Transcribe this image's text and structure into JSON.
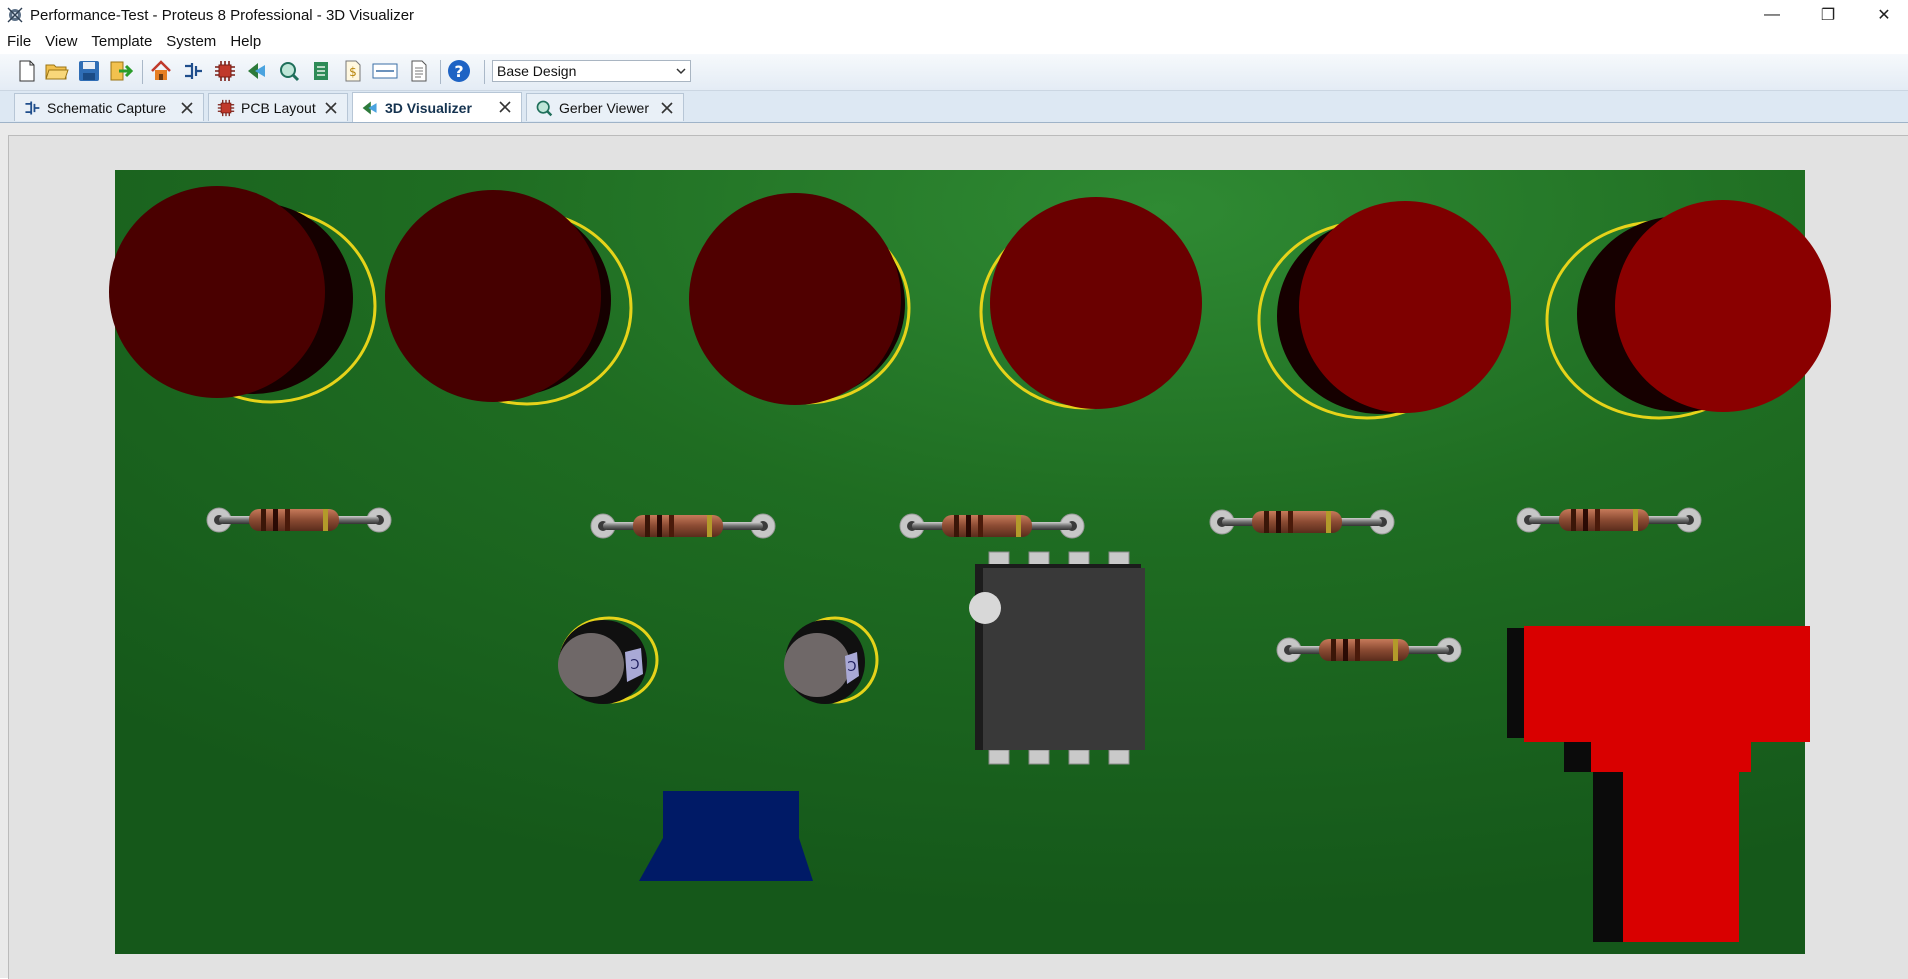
{
  "window": {
    "title": "Performance-Test - Proteus 8 Professional - 3D Visualizer",
    "controls": {
      "minimize": "—",
      "restore": "❐",
      "close": "✕"
    }
  },
  "menu": {
    "items": [
      "File",
      "View",
      "Template",
      "System",
      "Help"
    ]
  },
  "toolbar": {
    "buttons": [
      "new-file-icon",
      "open-folder-icon",
      "save-icon",
      "import-icon",
      "home-icon",
      "schematic-icon",
      "pcb-icon",
      "3d-visualizer-icon",
      "gerber-icon",
      "bom-icon",
      "cost-icon",
      "vsm-debug-icon",
      "notes-icon",
      "help-icon"
    ],
    "design_select": {
      "value": "Base Design"
    }
  },
  "tabs": [
    {
      "label": "Schematic Capture",
      "icon": "schematic-icon",
      "active": false
    },
    {
      "label": "PCB Layout",
      "icon": "pcb-icon",
      "active": false
    },
    {
      "label": "3D Visualizer",
      "icon": "3d-visualizer-icon",
      "active": true
    },
    {
      "label": "Gerber Viewer",
      "icon": "gerber-icon",
      "active": false
    }
  ],
  "scene": {
    "board_color": "#1e6b1e",
    "led_color": "#7a0000",
    "led_count": 6,
    "resistor_count": 6,
    "capacitor_count": 2,
    "ic": "DIP-8",
    "connector_color": "#dd0000",
    "block_color": "#001a66"
  }
}
